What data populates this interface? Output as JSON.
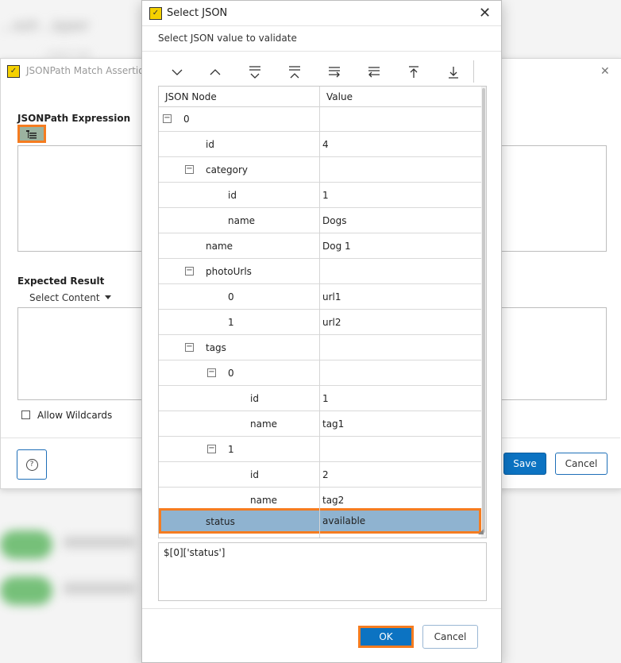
{
  "background": {
    "blurred_title": "...esh ..ipper",
    "blurred_small": "...ment rule"
  },
  "back_dialog": {
    "title": "JSONPath Match Assertion",
    "icon": "parasoft-app-icon",
    "jsonpath_label": "JSONPath Expression",
    "expected_label": "Expected Result",
    "select_content": "Select Content",
    "allow_wildcards": "Allow Wildcards",
    "save": "Save",
    "cancel": "Cancel",
    "help_icon": "?"
  },
  "modal": {
    "title": "Select JSON",
    "subtitle": "Select JSON value to validate",
    "toolbar": [
      "expand-icon",
      "collapse-icon",
      "expand-all-icon",
      "collapse-all-icon",
      "indent-right-icon",
      "indent-left-icon",
      "move-top-icon",
      "move-bottom-icon"
    ],
    "columns": {
      "node": "JSON Node",
      "value": "Value"
    },
    "rows": [
      {
        "node": "0",
        "value": ""
      },
      {
        "node": "id",
        "value": "4"
      },
      {
        "node": "category",
        "value": ""
      },
      {
        "node": "id",
        "value": "1"
      },
      {
        "node": "name",
        "value": "Dogs"
      },
      {
        "node": "name",
        "value": "Dog 1"
      },
      {
        "node": "photoUrls",
        "value": ""
      },
      {
        "node": "0",
        "value": "url1"
      },
      {
        "node": "1",
        "value": "url2"
      },
      {
        "node": "tags",
        "value": ""
      },
      {
        "node": "0",
        "value": ""
      },
      {
        "node": "id",
        "value": "1"
      },
      {
        "node": "name",
        "value": "tag1"
      },
      {
        "node": "1",
        "value": ""
      },
      {
        "node": "id",
        "value": "2"
      },
      {
        "node": "name",
        "value": "tag2"
      },
      {
        "node": "status",
        "value": "available"
      }
    ],
    "selected_path": "$[0]['status']",
    "ok": "OK",
    "cancel": "Cancel"
  }
}
